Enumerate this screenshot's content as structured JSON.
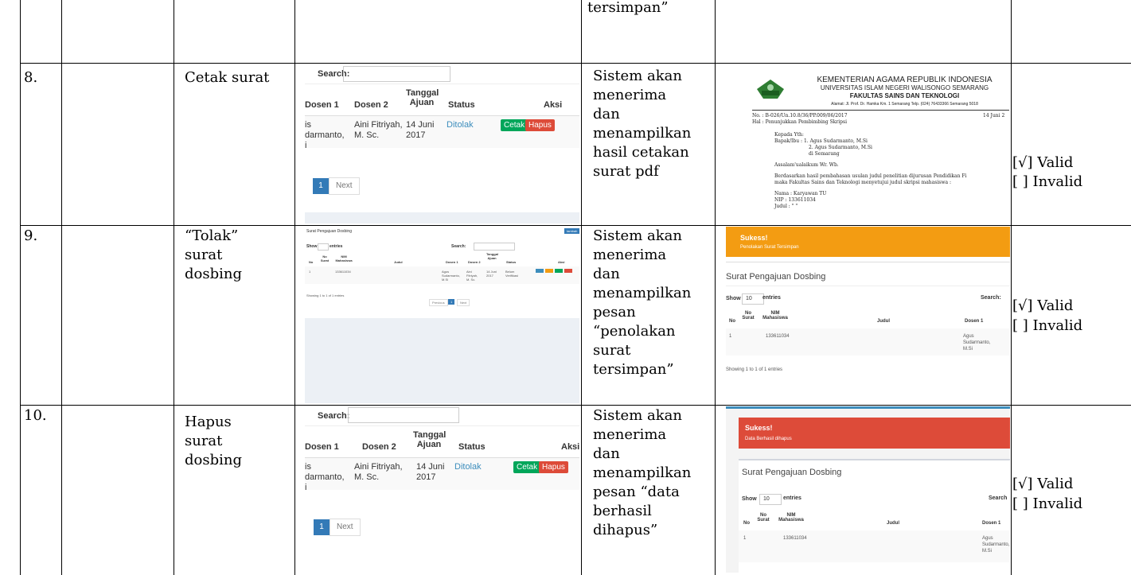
{
  "top_row": {
    "expected_tail": "tersimpan”"
  },
  "rows": [
    {
      "no": "8.",
      "test": "Cetak surat",
      "expected": [
        "Sistem akan",
        "menerima",
        "dan",
        "menampilkan",
        "hasil cetakan",
        "surat pdf"
      ],
      "valid": "[√] Valid",
      "invalid": "[ ] Invalid"
    },
    {
      "no": "9.",
      "test": [
        "“Tolak”",
        "surat",
        "dosbing"
      ],
      "expected": [
        "Sistem akan",
        "menerima",
        "dan",
        "menampilkan",
        "pesan",
        "“penolakan",
        "surat",
        "tersimpan”"
      ],
      "valid": "[√] Valid",
      "invalid": "[ ] Invalid"
    },
    {
      "no": "10.",
      "test": [
        "Hapus",
        "surat",
        "dosbing"
      ],
      "expected": [
        "Sistem akan",
        "menerima",
        "dan",
        "menampilkan",
        "pesan “data",
        "berhasil",
        "dihapus”"
      ],
      "valid": "[√] Valid",
      "invalid": "[ ] Invalid"
    }
  ],
  "shot_row8": {
    "search_label": "Search:",
    "headers": [
      "Dosen 1",
      "Dosen 2",
      "Tanggal Ajuan",
      "Status",
      "Aksi"
    ],
    "cells": [
      "is darmanto, i",
      "Aini Fitriyah, M. Sc.",
      "14 Juni 2017",
      "Ditolak"
    ],
    "btn_cetak": "Cetak",
    "btn_hapus": "Hapus",
    "page": "1",
    "next": "Next"
  },
  "pdf": {
    "ministry": "KEMENTERIAN AGAMA REPUBLIK INDONESIA",
    "univ": "UNIVERSITAS ISLAM NEGERI WALISONGO SEMARANG",
    "faculty": "FAKULTAS SAINS DAN TEKNOLOGI",
    "address": "Alamat: Jl. Prof. Dr. Hamka Km. 1 Semarang Telp. (024) 76433366 Semarang 5018",
    "no": "No.   : B-026/Un.10.8/36/PP.009/06/2017",
    "date": "14 Juni 2",
    "hal": "Hal   : Penunjukkan Pembimbing Skripsi",
    "kepada": "Kepada Yth:",
    "bapak": "Bapak/Ibu :  1. Agus Sudarmanto, M.Si",
    "second": "2. Agus Sudarmanto, M.Si",
    "place": "di Semarang",
    "salam": "Assalam'ualaikum Wr. Wb.",
    "body1": "Berdasarkan hasil pembahasan usulan judul penelitian dijurusan Pendidikan Fi",
    "body2": "maka Fakultas Sains dan Teknologi menyetujui judul skripsi mahasiswa :",
    "nama": "Nama      : Karyawan TU",
    "nip": "NIP        : 133611034",
    "judul": "Judul      : \" \""
  },
  "shot_row9_left": {
    "title": "Surat Pengajuan Dosbing",
    "btn": "tambah",
    "show": "Show",
    "entries": "entries",
    "search": "Search:",
    "headers": [
      "No",
      "No Surat",
      "NIM Mahasiswa",
      "Judul",
      "Dosen 1",
      "Dosen 2",
      "Tanggal Ajuan",
      "Status",
      "Aksi"
    ],
    "cells": [
      "1",
      "",
      "133611034",
      "",
      "Agus Sudarmanto, M.Si",
      "Aini Fitriyah, M. Sc.",
      "14 Juni 2017",
      "Belum Verifikasi"
    ],
    "footer": "Showing 1 to 1 of 1 entries",
    "prev": "Previous",
    "page": "1",
    "next": "Next"
  },
  "shot_row9_right": {
    "alert_title": "Sukess!",
    "alert_msg": "Penolakan Surat Tersimpan",
    "title": "Surat Pengajuan Dosbing",
    "show": "Show",
    "show_val": "10",
    "entries": "entries",
    "search": "Search:",
    "headers": [
      "No",
      "No Surat",
      "NIM Mahasiswa",
      "Judul",
      "Dosen 1"
    ],
    "cells": [
      "1",
      "",
      "133611034",
      "",
      "Agus Sudarmanto, M.Si"
    ],
    "footer": "Showing 1 to 1 of 1 entries"
  },
  "shot_row10_left": {
    "search_label": "Search:",
    "headers": [
      "Dosen 1",
      "Dosen 2",
      "Tanggal Ajuan",
      "Status",
      "Aksi"
    ],
    "cells": [
      "is darmanto, i",
      "Aini Fitriyah, M. Sc.",
      "14 Juni 2017",
      "Ditolak"
    ],
    "btn_cetak": "Cetak",
    "btn_hapus": "Hapus",
    "page": "1",
    "next": "Next"
  },
  "shot_row10_right": {
    "alert_title": "Sukess!",
    "alert_msg": "Data Berhasil dihapus",
    "title": "Surat Pengajuan Dosbing",
    "show": "Show",
    "show_val": "10",
    "entries": "entries",
    "search": "Search",
    "headers": [
      "No",
      "No Surat",
      "NIM Mahasiswa",
      "Judul",
      "Dosen 1"
    ],
    "cells": [
      "1",
      "",
      "133611034",
      "",
      "Agus Sudarmanto, M.Si"
    ]
  },
  "colors": {
    "primary": "#337ab7",
    "success": "#00a65a",
    "danger": "#dd4b39",
    "warning": "#f39c12",
    "link": "#3c8dbc"
  }
}
